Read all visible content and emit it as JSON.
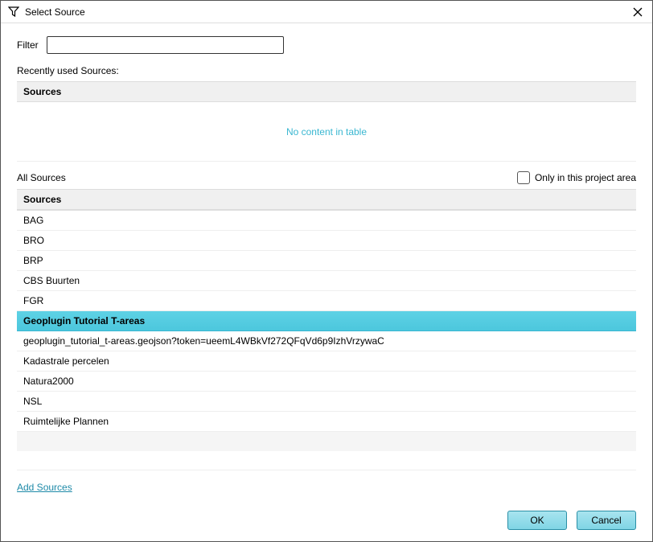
{
  "window": {
    "title": "Select Source"
  },
  "filter": {
    "label": "Filter",
    "value": ""
  },
  "recent": {
    "label": "Recently used Sources:",
    "header": "Sources",
    "empty_text": "No content in table"
  },
  "allSources": {
    "label": "All Sources",
    "checkbox_label": "Only in this project area",
    "checkbox_checked": false,
    "header": "Sources",
    "items": [
      {
        "label": "BAG",
        "selected": false
      },
      {
        "label": "BRO",
        "selected": false
      },
      {
        "label": "BRP",
        "selected": false
      },
      {
        "label": "CBS Buurten",
        "selected": false
      },
      {
        "label": "FGR",
        "selected": false
      },
      {
        "label": "Geoplugin Tutorial T-areas",
        "selected": true
      },
      {
        "label": "geoplugin_tutorial_t-areas.geojson?token=ueemL4WBkVf272QFqVd6p9IzhVrzywaC",
        "selected": false,
        "sub": true
      },
      {
        "label": "Kadastrale percelen",
        "selected": false
      },
      {
        "label": "Natura2000",
        "selected": false
      },
      {
        "label": "NSL",
        "selected": false
      },
      {
        "label": "Ruimtelijke Plannen",
        "selected": false
      }
    ]
  },
  "addSourcesLink": "Add Sources",
  "buttons": {
    "ok": "OK",
    "cancel": "Cancel"
  }
}
